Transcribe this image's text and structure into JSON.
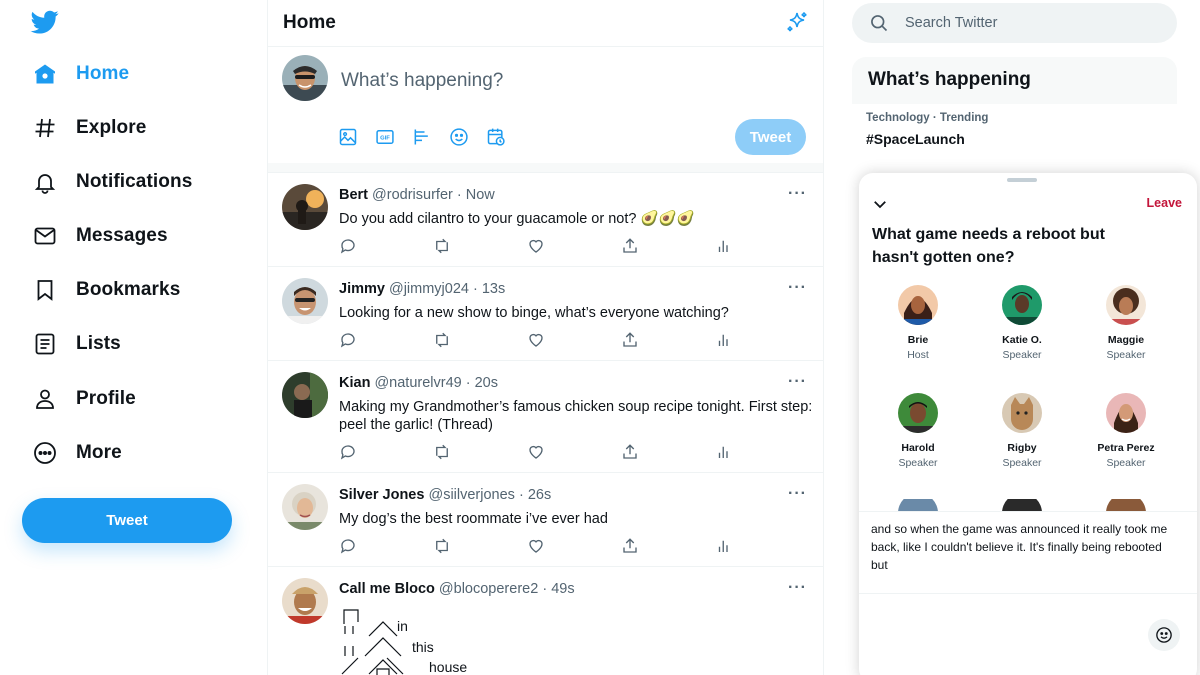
{
  "sidebar": {
    "nav": [
      {
        "label": "Home",
        "icon": "home-icon",
        "active": true
      },
      {
        "label": "Explore",
        "icon": "hashtag-icon"
      },
      {
        "label": "Notifications",
        "icon": "bell-icon"
      },
      {
        "label": "Messages",
        "icon": "envelope-icon"
      },
      {
        "label": "Bookmarks",
        "icon": "bookmark-icon"
      },
      {
        "label": "Lists",
        "icon": "list-icon"
      },
      {
        "label": "Profile",
        "icon": "person-icon"
      },
      {
        "label": "More",
        "icon": "more-circle-icon"
      }
    ],
    "tweet_button": "Tweet"
  },
  "main": {
    "title": "Home",
    "composer": {
      "placeholder": "What’s happening?",
      "tweet_button": "Tweet"
    },
    "tweets": [
      {
        "name": "Bert",
        "handle": "@rodrisurfer",
        "time": "Now",
        "text": "Do you add cilantro to your guacamole or not? 🥑🥑🥑"
      },
      {
        "name": "Jimmy",
        "handle": "@jimmyj024",
        "time": "13s",
        "text": "Looking for a new show to binge, what’s everyone watching?"
      },
      {
        "name": "Kian",
        "handle": "@naturelvr49",
        "time": "20s",
        "text": "Making my Grandmother’s famous chicken soup recipe tonight. First step: peel the garlic! (Thread)"
      },
      {
        "name": "Silver Jones",
        "handle": "@siilverjones",
        "time": "26s",
        "text": "My dog’s the best roommate i’ve ever had"
      },
      {
        "name": "Call me Bloco",
        "handle": "@blocoperere2",
        "time": "49s",
        "text": ""
      }
    ],
    "ascii_words": [
      "in",
      "this",
      "house"
    ]
  },
  "right": {
    "search_placeholder": "Search Twitter",
    "trends_title": "What’s happening",
    "trend": {
      "meta": "Technology · Trending",
      "tag": "#SpaceLaunch"
    },
    "space": {
      "leave": "Leave",
      "title": "What game needs a reboot but hasn't gotten one?",
      "speakers": [
        {
          "name": "Brie",
          "role": "Host"
        },
        {
          "name": "Katie O.",
          "role": "Speaker"
        },
        {
          "name": "Maggie",
          "role": "Speaker"
        },
        {
          "name": "Harold",
          "role": "Speaker"
        },
        {
          "name": "Rigby",
          "role": "Speaker"
        },
        {
          "name": "Petra Perez",
          "role": "Speaker"
        }
      ],
      "caption": "and so when the game was announced it really took me back, like I couldn't believe it. It's finally being rebooted but"
    }
  },
  "colors": {
    "accent": "#1d9bf0",
    "leave": "#c3153a"
  }
}
